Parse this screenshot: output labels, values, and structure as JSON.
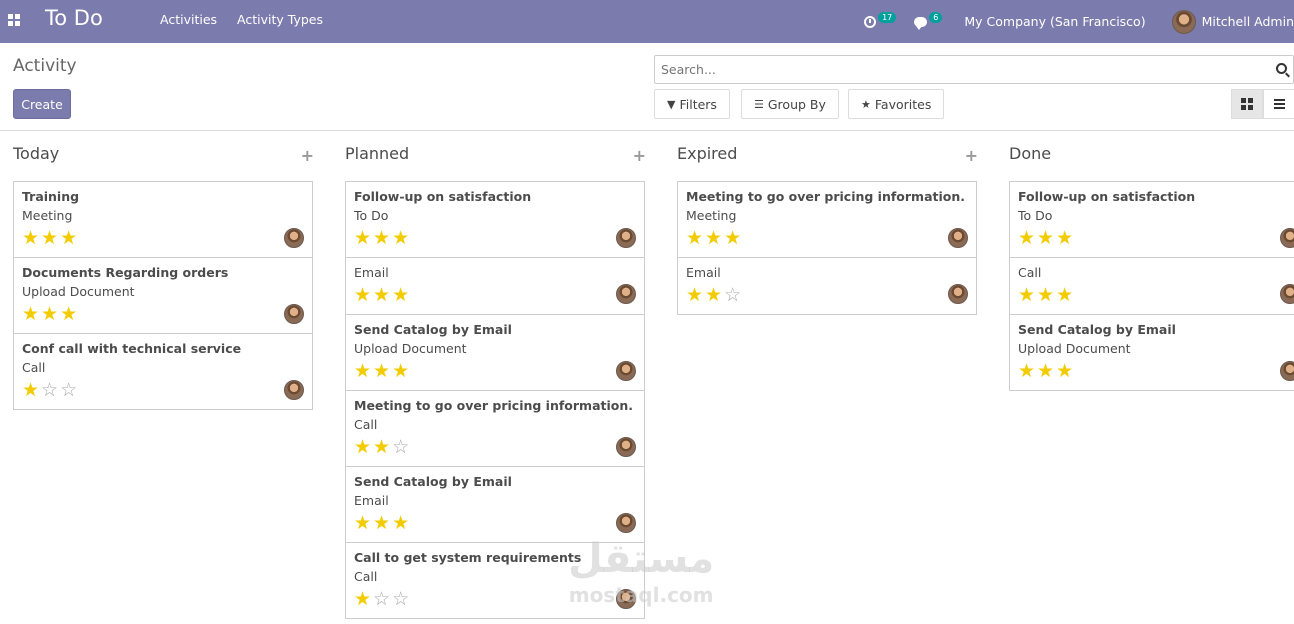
{
  "navbar": {
    "brand": "To Do",
    "menu": [
      "Activities",
      "Activity Types"
    ],
    "activity_badge": "17",
    "message_badge": "6",
    "company": "My Company (San Francisco)",
    "user": "Mitchell Admin"
  },
  "control": {
    "breadcrumb": "Activity",
    "create_label": "Create",
    "search_placeholder": "Search...",
    "filters_label": "Filters",
    "groupby_label": "Group By",
    "favorites_label": "Favorites"
  },
  "colors": {
    "navbar": "#7c7bad",
    "star": "#f3cc00",
    "badge": "#00a09d"
  },
  "columns": [
    {
      "title": "Today",
      "cards": [
        {
          "title": "Training",
          "type": "Meeting",
          "stars": 3
        },
        {
          "title": "Documents Regarding orders",
          "type": "Upload Document",
          "stars": 3
        },
        {
          "title": "Conf call with technical service",
          "type": "Call",
          "stars": 1
        }
      ]
    },
    {
      "title": "Planned",
      "cards": [
        {
          "title": "Follow-up on satisfaction",
          "type": "To Do",
          "stars": 3
        },
        {
          "title": "",
          "type": "Email",
          "stars": 3
        },
        {
          "title": "Send Catalog by Email",
          "type": "Upload Document",
          "stars": 3
        },
        {
          "title": "Meeting to go over pricing information.",
          "type": "Call",
          "stars": 2
        },
        {
          "title": "Send Catalog by Email",
          "type": "Email",
          "stars": 3
        },
        {
          "title": "Call to get system requirements",
          "type": "Call",
          "stars": 1
        }
      ]
    },
    {
      "title": "Expired",
      "cards": [
        {
          "title": "Meeting to go over pricing information.",
          "type": "Meeting",
          "stars": 3
        },
        {
          "title": "",
          "type": "Email",
          "stars": 2
        }
      ]
    },
    {
      "title": "Done",
      "cards": [
        {
          "title": "Follow-up on satisfaction",
          "type": "To Do",
          "stars": 3
        },
        {
          "title": "",
          "type": "Call",
          "stars": 3
        },
        {
          "title": "Send Catalog by Email",
          "type": "Upload Document",
          "stars": 3
        }
      ]
    }
  ],
  "watermark": {
    "arabic": "مستقل",
    "latin": "mostaql.com"
  }
}
